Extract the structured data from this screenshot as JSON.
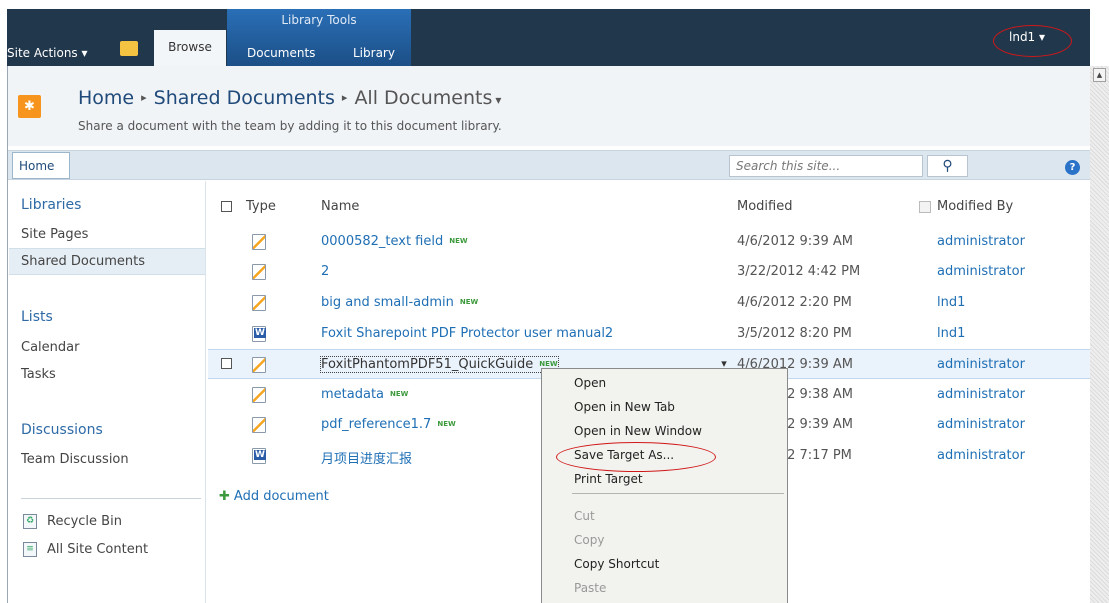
{
  "ribbon": {
    "site_actions": "Site Actions ▾",
    "browse_tab": "Browse",
    "context_group": "Library Tools",
    "documents_tab": "Documents",
    "library_tab": "Library",
    "user": "lnd1 ▾"
  },
  "title": {
    "crumb_home": "Home",
    "crumb_library": "Shared Documents",
    "crumb_view": "All Documents",
    "crumb_view_arrow": "▾",
    "sep": "▸",
    "description": "Share a document with the team by adding it to this document library."
  },
  "topnav": {
    "home": "Home",
    "search_placeholder": "Search this site...",
    "search_icon": "search-icon",
    "help_icon": "help-icon",
    "help_glyph": "?"
  },
  "quicklaunch": {
    "libraries_heading": "Libraries",
    "libraries": [
      "Site Pages",
      "Shared Documents"
    ],
    "lists_heading": "Lists",
    "lists": [
      "Calendar",
      "Tasks"
    ],
    "discussions_heading": "Discussions",
    "discussions": [
      "Team Discussion"
    ],
    "recycle_bin": "Recycle Bin",
    "all_site_content": "All Site Content"
  },
  "list": {
    "columns": {
      "type": "Type",
      "name": "Name",
      "modified": "Modified",
      "modified_by": "Modified By"
    },
    "new_badge": "NEW",
    "rows": [
      {
        "name": "0000582_text field",
        "is_new": true,
        "modified": "4/6/2012 9:39 AM",
        "modified_by": "administrator",
        "icon": "pdf-icon"
      },
      {
        "name": "2",
        "is_new": false,
        "modified": "3/22/2012 4:42 PM",
        "modified_by": "administrator",
        "icon": "pdf-icon"
      },
      {
        "name": "big and small-admin",
        "is_new": true,
        "modified": "4/6/2012 2:20 PM",
        "modified_by": "lnd1",
        "icon": "pdf-icon"
      },
      {
        "name": "Foxit Sharepoint PDF Protector user manual2",
        "is_new": false,
        "modified": "3/5/2012 8:20 PM",
        "modified_by": "lnd1",
        "icon": "word-icon"
      },
      {
        "name": "FoxitPhantomPDF51_QuickGuide",
        "is_new": true,
        "modified": "4/6/2012 9:39 AM",
        "modified_by": "administrator",
        "icon": "pdf-icon"
      },
      {
        "name": "metadata",
        "is_new": true,
        "modified": "4/6/2012 9:38 AM",
        "modified_by": "administrator",
        "icon": "pdf-icon"
      },
      {
        "name": "pdf_reference1.7",
        "is_new": true,
        "modified": "4/6/2012 9:39 AM",
        "modified_by": "administrator",
        "icon": "pdf-icon"
      },
      {
        "name": "月项目进度汇报",
        "is_new": false,
        "modified": "4/6/2012 7:17 PM",
        "modified_by": "administrator",
        "icon": "word-icon"
      }
    ],
    "add_document": "Add document"
  },
  "context_menu": {
    "items": [
      "Open",
      "Open in New Tab",
      "Open in New Window",
      "Save Target As...",
      "Print Target",
      "Cut",
      "Copy",
      "Copy Shortcut",
      "Paste"
    ],
    "disabled": [
      "Cut",
      "Copy",
      "Paste"
    ]
  },
  "colors": {
    "ribbon": "#21374c",
    "context_tab": "#2a6fb7",
    "link": "#1f6fb5",
    "highlight_ring": "#d01818"
  }
}
